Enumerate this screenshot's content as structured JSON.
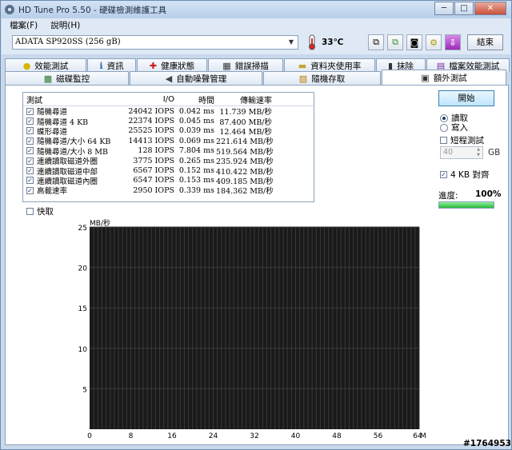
{
  "window": {
    "title": "HD Tune Pro 5.50 - 硬碟檢測維護工具"
  },
  "window_controls": {
    "minimize": "─",
    "maximize": "□",
    "close": "✕"
  },
  "menu": {
    "items": [
      "檔案(F)",
      "說明(H)"
    ]
  },
  "toolbar": {
    "drive": "ADATA SP920SS (256 gB)",
    "temperature": "33℃",
    "exit_label": "結束"
  },
  "tabs_top": [
    {
      "label": "效能測試",
      "icon": "bulb-icon"
    },
    {
      "label": "資訊",
      "icon": "info-icon"
    },
    {
      "label": "健康狀態",
      "icon": "health-cross-icon"
    },
    {
      "label": "錯誤掃描",
      "icon": "error-scan-icon"
    },
    {
      "label": "資料夾使用率",
      "icon": "folder-icon"
    },
    {
      "label": "抹除",
      "icon": "trash-icon"
    },
    {
      "label": "檔案效能測試",
      "icon": "file-benchmark-icon"
    }
  ],
  "tabs_bottom": [
    {
      "label": "磁碟監控",
      "icon": "disk-monitor-icon"
    },
    {
      "label": "自動噪聲管理",
      "icon": "speaker-icon"
    },
    {
      "label": "隨機存取",
      "icon": "random-access-icon"
    },
    {
      "label": "額外測試",
      "icon": "extra-tests-icon",
      "active": true
    }
  ],
  "results": {
    "headers": [
      "測試",
      "I/O",
      "時間",
      "傳輸速率"
    ],
    "rows": [
      {
        "test": "隨機尋道",
        "io": "24042 IOPS",
        "time": "0.042 ms",
        "rate": "11.739 MB/秒"
      },
      {
        "test": "隨機尋道 4 KB",
        "io": "22374 IOPS",
        "time": "0.045 ms",
        "rate": "87.400 MB/秒"
      },
      {
        "test": "蝶形尋道",
        "io": "25525 IOPS",
        "time": "0.039 ms",
        "rate": "12.464 MB/秒"
      },
      {
        "test": "隨機尋道/大小 64 KB",
        "io": "14413 IOPS",
        "time": "0.069 ms",
        "rate": "221.614 MB/秒"
      },
      {
        "test": "隨機尋道/大小 8 MB",
        "io": "128 IOPS",
        "time": "7.804 ms",
        "rate": "519.564 MB/秒"
      },
      {
        "test": "連續讀取磁道外圈",
        "io": "3775 IOPS",
        "time": "0.265 ms",
        "rate": "235.924 MB/秒"
      },
      {
        "test": "連續讀取磁道中部",
        "io": "6567 IOPS",
        "time": "0.152 ms",
        "rate": "410.422 MB/秒"
      },
      {
        "test": "連續讀取磁道內圈",
        "io": "6547 IOPS",
        "time": "0.153 ms",
        "rate": "409.185 MB/秒"
      },
      {
        "test": "高載速率",
        "io": "2950 IOPS",
        "time": "0.339 ms",
        "rate": "184.362 MB/秒"
      }
    ]
  },
  "fast_label": "快取",
  "controls": {
    "start_label": "開始",
    "read_label": "讀取",
    "write_label": "寫入",
    "short_test_label": "短程測試",
    "short_test_value": "40",
    "short_test_unit": "GB",
    "align_label": "4 KB 對齊",
    "progress_label": "進度:",
    "progress_text": "100%",
    "progress_value": 1.0
  },
  "chart_data": {
    "type": "line",
    "ylabel": "MB/秒",
    "xlabel": "",
    "x_unit": "MB",
    "ylim": [
      0,
      25
    ],
    "xlim": [
      0,
      64
    ],
    "yticks": [
      5,
      10,
      15,
      20,
      25
    ],
    "xticks": [
      0,
      8,
      16,
      24,
      32,
      40,
      48,
      56,
      64
    ],
    "grid": true,
    "series": []
  },
  "watermark": "#1764953"
}
